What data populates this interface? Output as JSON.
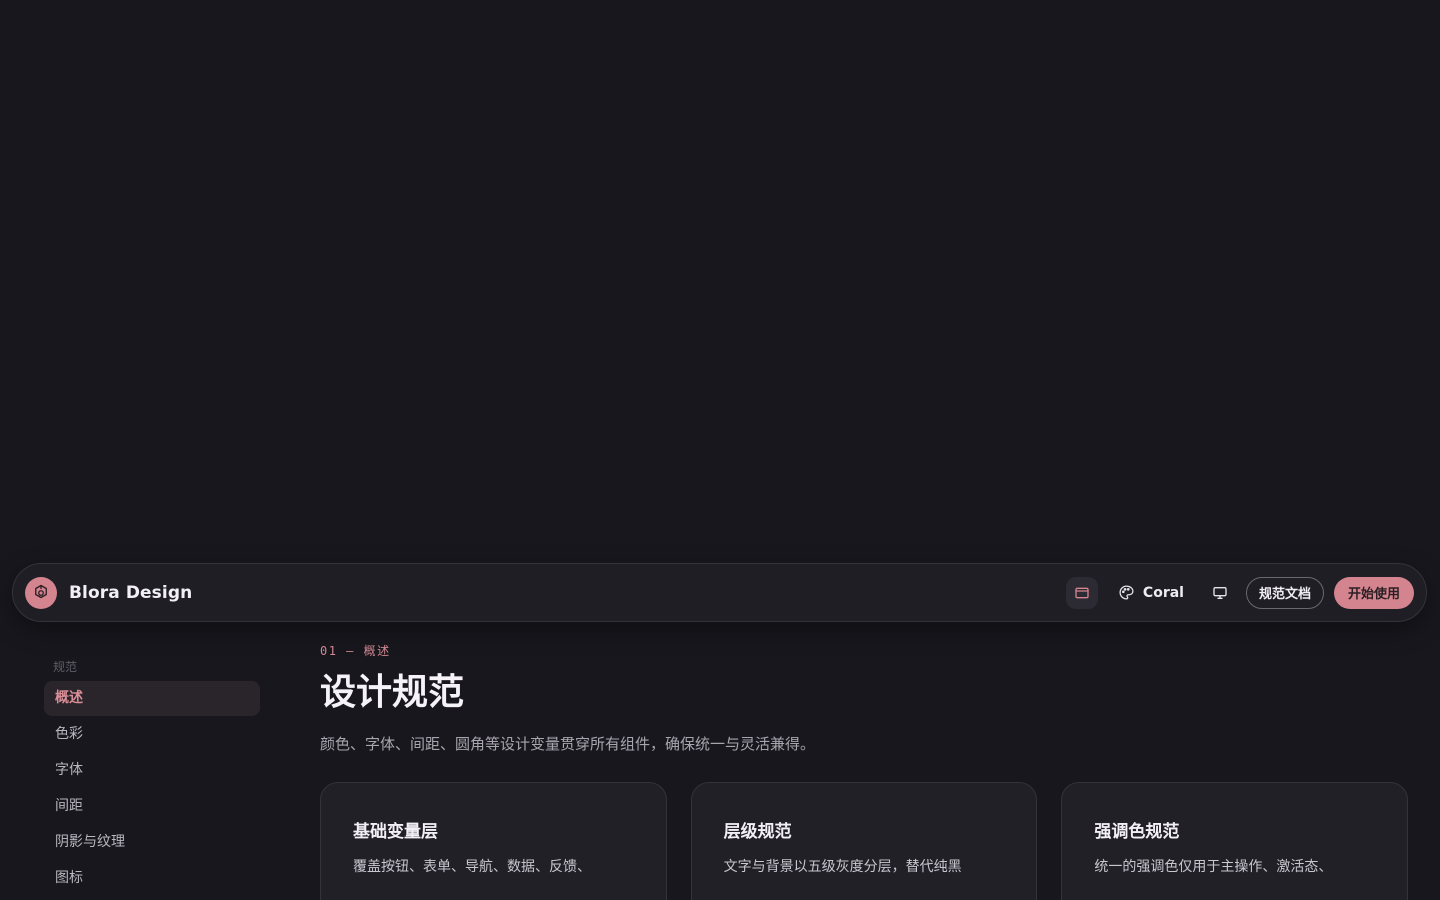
{
  "brand": {
    "name": "Blora Design"
  },
  "toolbar": {
    "theme_label": "Coral",
    "docs_label": "规范文档",
    "start_label": "开始使用"
  },
  "colors": {
    "accent": "#d4848f",
    "background": "#18171d",
    "surface": "#1f1e25"
  },
  "sidebar": {
    "section": "规范",
    "items": [
      {
        "label": "概述",
        "active": true
      },
      {
        "label": "色彩"
      },
      {
        "label": "字体"
      },
      {
        "label": "间距"
      },
      {
        "label": "阴影与纹理"
      },
      {
        "label": "图标"
      }
    ]
  },
  "main": {
    "eyebrow": "01 — 概述",
    "title": "设计规范",
    "description": "颜色、字体、间距、圆角等设计变量贯穿所有组件，确保统一与灵活兼得。",
    "cards": [
      {
        "title": "基础变量层",
        "text": "覆盖按钮、表单、导航、数据、反馈、"
      },
      {
        "title": "层级规范",
        "text": "文字与背景以五级灰度分层，替代纯黑"
      },
      {
        "title": "强调色规范",
        "text": "统一的强调色仅用于主操作、激活态、"
      }
    ]
  }
}
